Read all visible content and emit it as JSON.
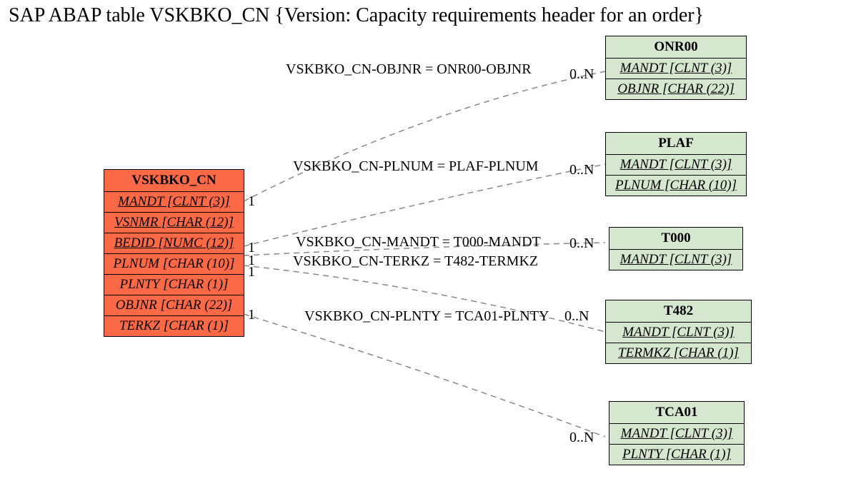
{
  "title": "SAP ABAP table VSKBKO_CN {Version: Capacity requirements header for an order}",
  "main": {
    "name": "VSKBKO_CN",
    "fields": [
      {
        "txt": "MANDT [CLNT (3)]",
        "role": "pk"
      },
      {
        "txt": "VSNMR [CHAR (12)]",
        "role": "pk"
      },
      {
        "txt": "BEDID [NUMC (12)]",
        "role": "pk"
      },
      {
        "txt": "PLNUM [CHAR (10)]",
        "role": "fk"
      },
      {
        "txt": "PLNTY [CHAR (1)]",
        "role": "fk"
      },
      {
        "txt": "OBJNR [CHAR (22)]",
        "role": "fk"
      },
      {
        "txt": "TERKZ [CHAR (1)]",
        "role": "fk"
      }
    ]
  },
  "targets": [
    {
      "name": "ONR00",
      "fields": [
        {
          "txt": "MANDT [CLNT (3)]",
          "role": "pk"
        },
        {
          "txt": "OBJNR [CHAR (22)]",
          "role": "pk"
        }
      ]
    },
    {
      "name": "PLAF",
      "fields": [
        {
          "txt": "MANDT [CLNT (3)]",
          "role": "pk"
        },
        {
          "txt": "PLNUM [CHAR (10)]",
          "role": "pk"
        }
      ]
    },
    {
      "name": "T000",
      "fields": [
        {
          "txt": "MANDT [CLNT (3)]",
          "role": "pk"
        }
      ]
    },
    {
      "name": "T482",
      "fields": [
        {
          "txt": "MANDT [CLNT (3)]",
          "role": "pk"
        },
        {
          "txt": "TERMKZ [CHAR (1)]",
          "role": "pk"
        }
      ]
    },
    {
      "name": "TCA01",
      "fields": [
        {
          "txt": "MANDT [CLNT (3)]",
          "role": "pk"
        },
        {
          "txt": "PLNTY [CHAR (1)]",
          "role": "pk"
        }
      ]
    }
  ],
  "links": [
    {
      "label": "VSKBKO_CN-OBJNR = ONR00-OBJNR",
      "card_l": "1",
      "card_r": "0..N"
    },
    {
      "label": "VSKBKO_CN-PLNUM = PLAF-PLNUM",
      "card_l": "1",
      "card_r": "0..N"
    },
    {
      "label": "VSKBKO_CN-MANDT = T000-MANDT",
      "card_l": "1",
      "card_r": "0..N"
    },
    {
      "label": "VSKBKO_CN-TERKZ = T482-TERMKZ",
      "card_l": "1",
      "card_r": ""
    },
    {
      "label": "VSKBKO_CN-PLNTY = TCA01-PLNTY",
      "card_l": "1",
      "card_r": "0..N"
    },
    {
      "label": "",
      "card_l": "",
      "card_r": "0..N"
    }
  ]
}
